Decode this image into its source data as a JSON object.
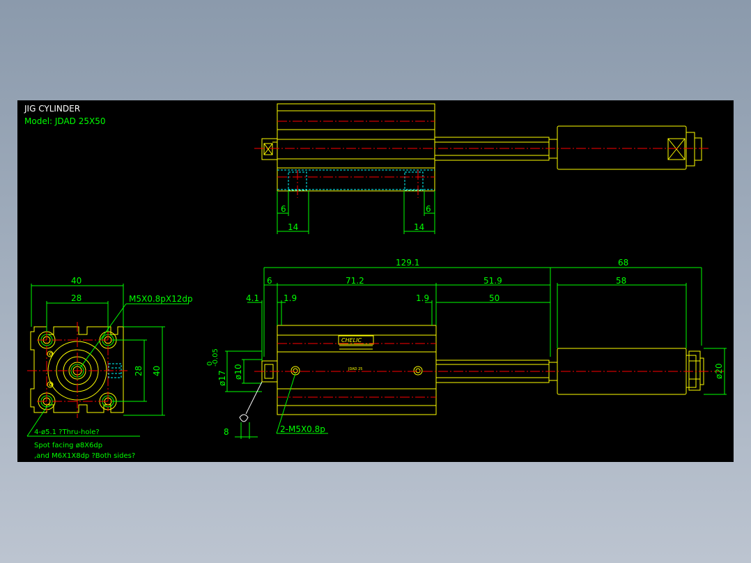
{
  "title_block": {
    "title": "JIG CYLINDER",
    "model": "Model:  JDAD 25X50"
  },
  "top_view": {
    "dim_left_6": "6",
    "dim_left_14": "14",
    "dim_right_6": "6",
    "dim_right_14": "14"
  },
  "side_view": {
    "dim_overall": "129.1",
    "dim_rod_ext": "68",
    "dim_6": "6",
    "dim_71_2": "71.2",
    "dim_51_9": "51.9",
    "dim_58": "58",
    "dim_4_1": "4.1",
    "dim_1_9a": "1.9",
    "dim_1_9b": "1.9",
    "dim_50": "50",
    "dim_phi10": "ø10",
    "dim_phi17": "ø17",
    "dim_phi17_tol": "-0.05",
    "dim_phi17_tol_top": "0",
    "dim_phi20": "ø20",
    "dim_8": "8",
    "note_ports": "2-M5X0.8p",
    "nameplate_brand": "CHELIC",
    "nameplate_model": "JDAD 25"
  },
  "end_view": {
    "dim_40_top": "40",
    "dim_28_top": "28",
    "dim_28_side": "28",
    "dim_40_side": "40",
    "note_thread": "M5X0.8pX12dp",
    "note_holes_1": "4-ø5.1 ?Thru-hole?",
    "note_holes_2": "Spot facing  ø8X6dp",
    "note_holes_3": ",and M6X1X8dp ?Both sides?"
  },
  "colors": {
    "background": "#000000",
    "outline": "#ffff00",
    "dimension": "#00ff00",
    "centerline": "#ff0000",
    "hidden": "#00ffff"
  }
}
